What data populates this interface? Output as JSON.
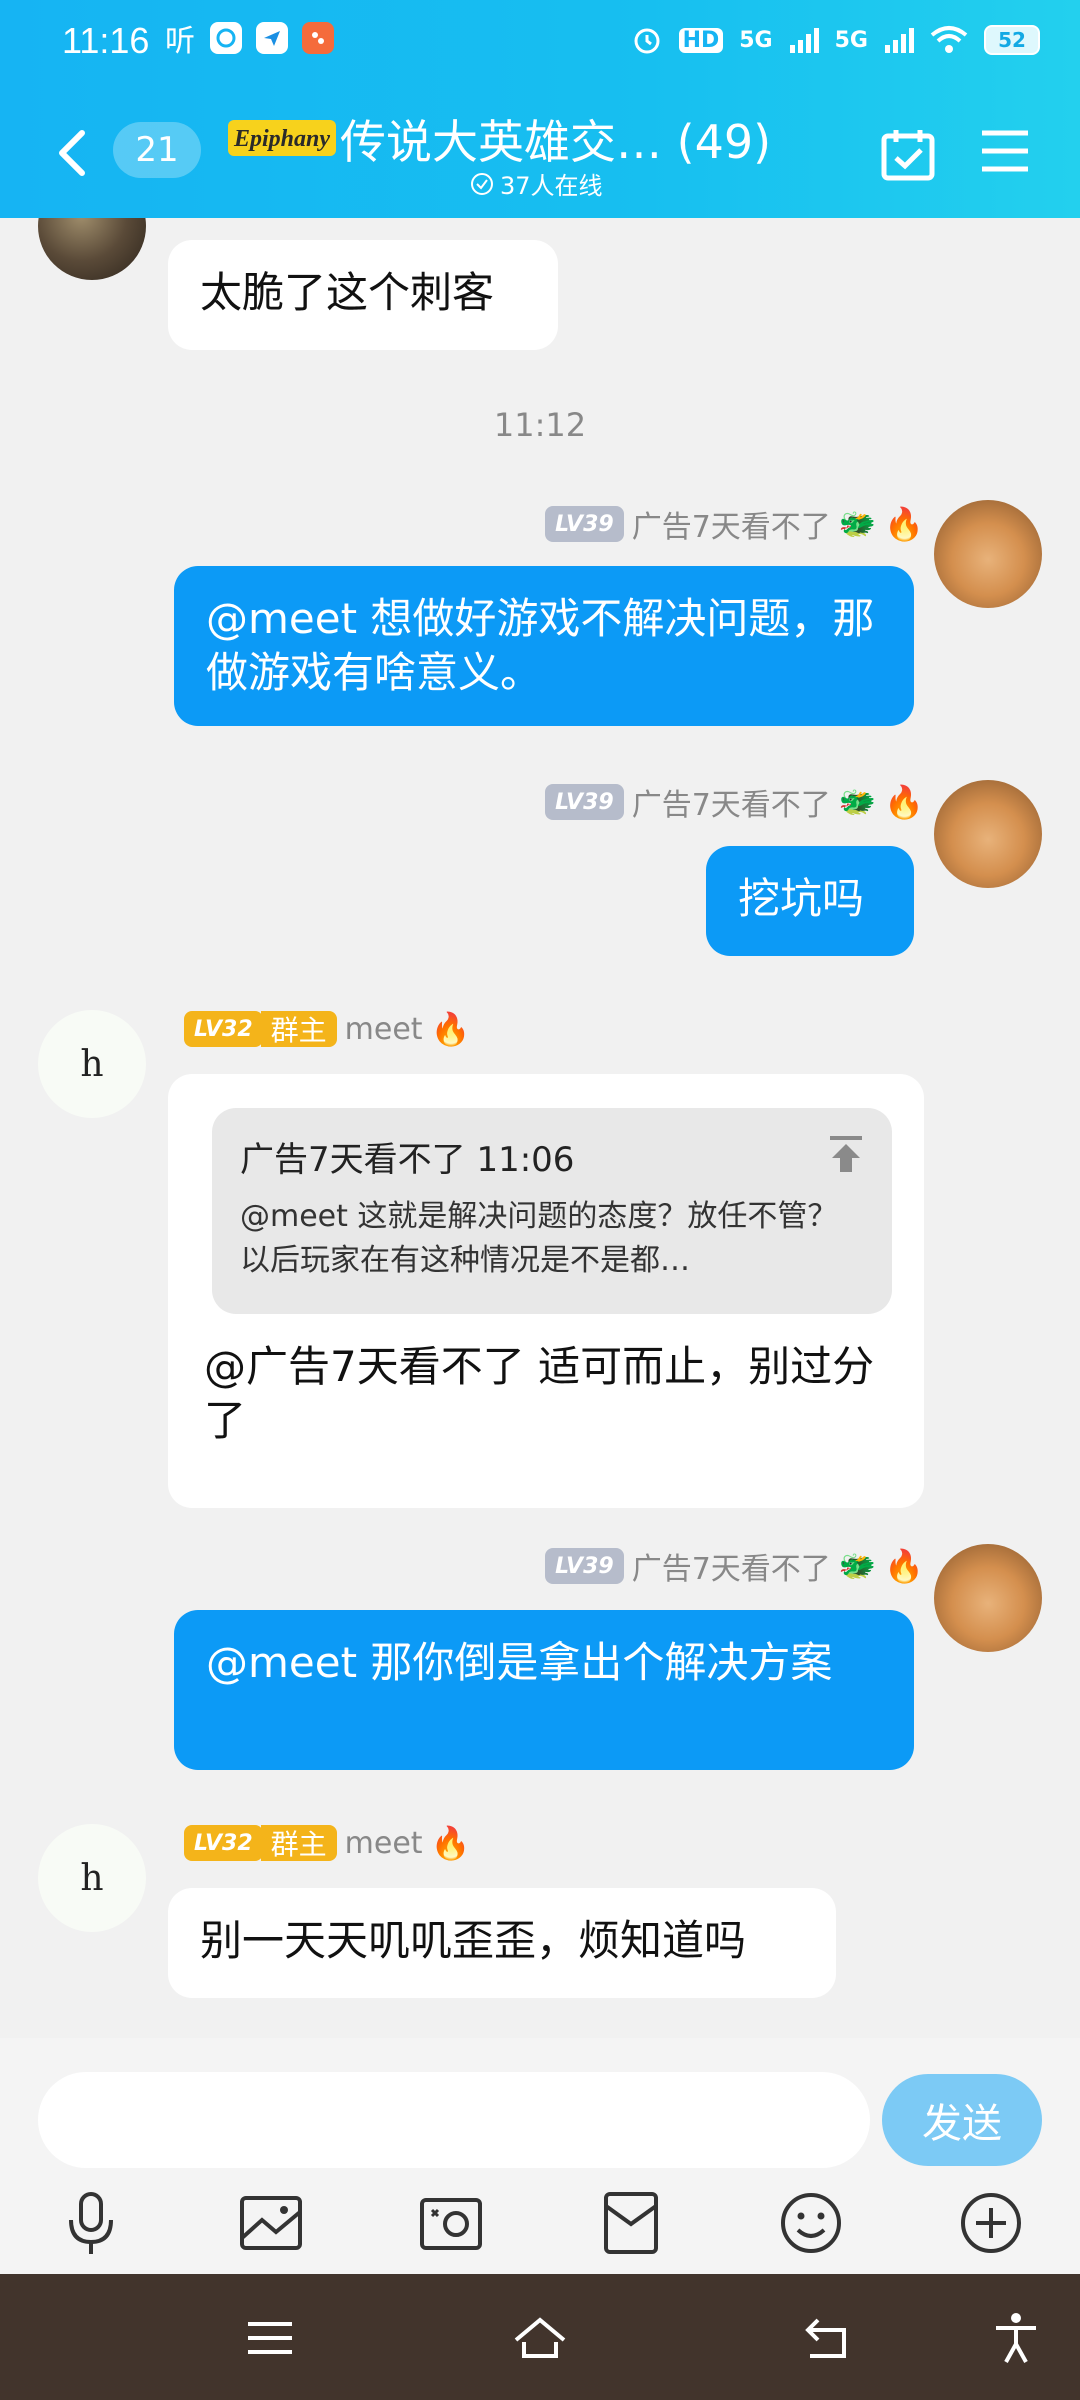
{
  "status": {
    "time": "11:16",
    "left_icons": [
      "听",
      "browser-icon",
      "send-icon",
      "app-icon"
    ],
    "right_icons": [
      "alarm-icon",
      "HD",
      "5G",
      "5G",
      "wifi-icon"
    ],
    "battery": "52"
  },
  "header": {
    "unread": "21",
    "logo_text": "Epiphany",
    "title": "传说大英雄交…  (49)",
    "online": "37人在线"
  },
  "messages": {
    "m0_text": "太脆了这个刺客",
    "timestamp": "11:12",
    "m1_lv": "LV39",
    "m1_name": "广告7天看不了",
    "m1_text": "@meet  想做好游戏不解决问题，那做游戏有啥意义。",
    "m2_lv": "LV39",
    "m2_name": "广告7天看不了",
    "m2_text": "挖坑吗",
    "m3_avatar": "h",
    "m3_lv": "LV32",
    "m3_role": "群主",
    "m3_name": "meet",
    "m3_quote_head": "广告7天看不了  11:06",
    "m3_quote_body": "@meet  这就是解决问题的态度？放任不管？以后玩家在有这种情况是不是都…",
    "m3_text": "@广告7天看不了  适可而止，别过分了",
    "m4_lv": "LV39",
    "m4_name": "广告7天看不了",
    "m4_text": "@meet  那你倒是拿出个解决方案",
    "m5_avatar": "h",
    "m5_lv": "LV32",
    "m5_role": "群主",
    "m5_name": "meet",
    "m5_text": "别一天天叽叽歪歪，烦知道吗"
  },
  "input": {
    "value": "",
    "send_label": "发送"
  },
  "colors": {
    "header": "#16b4f3",
    "bubble_blue": "#0c9af6",
    "send_disabled": "#7ccaf5",
    "level_gray": "#b6bccb",
    "level_gold": "#f4b41a",
    "navbar": "#42342c"
  }
}
